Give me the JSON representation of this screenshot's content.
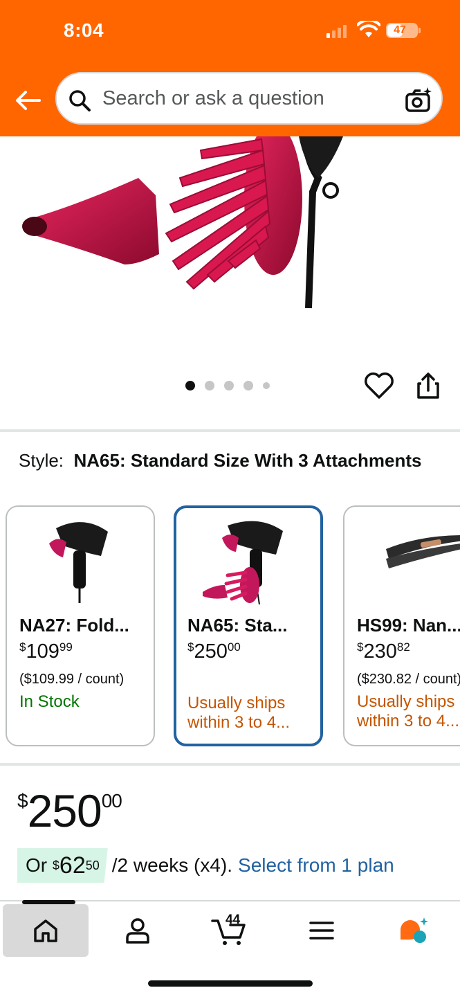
{
  "status_bar": {
    "time": "8:04",
    "battery": "47"
  },
  "header": {
    "search_placeholder": "Search or ask a question"
  },
  "gallery": {
    "dots": 5,
    "active_dot": 0
  },
  "style": {
    "label": "Style:",
    "value": "NA65: Standard Size With 3 Attachments"
  },
  "variants": [
    {
      "title": "NA27: Fold...",
      "price_whole": "109",
      "price_cents": "99",
      "unit": "($109.99 / count)",
      "availability": "In Stock"
    },
    {
      "title": "NA65: Sta...",
      "price_whole": "250",
      "price_cents": "00",
      "shipping_line1": "Usually ships",
      "shipping_line2": "within 3 to 4..."
    },
    {
      "title": "HS99: Nan...",
      "price_whole": "230",
      "price_cents": "82",
      "unit": "($230.82 / count)",
      "shipping_line1": "Usually ships",
      "shipping_line2": "within 3 to 4..."
    }
  ],
  "price": {
    "currency": "$",
    "whole": "250",
    "cents": "00"
  },
  "installment": {
    "prefix": "Or",
    "currency": "$",
    "whole": "62",
    "cents": "50",
    "period": "/2 weeks (x4).",
    "link": "Select from 1 plan"
  },
  "bottom_nav": {
    "cart_count": "44"
  },
  "colors": {
    "header": "#ff6600",
    "link": "#2162a1",
    "in_stock": "#007600",
    "shipping": "#c45500",
    "selected_border": "#2162a1"
  }
}
